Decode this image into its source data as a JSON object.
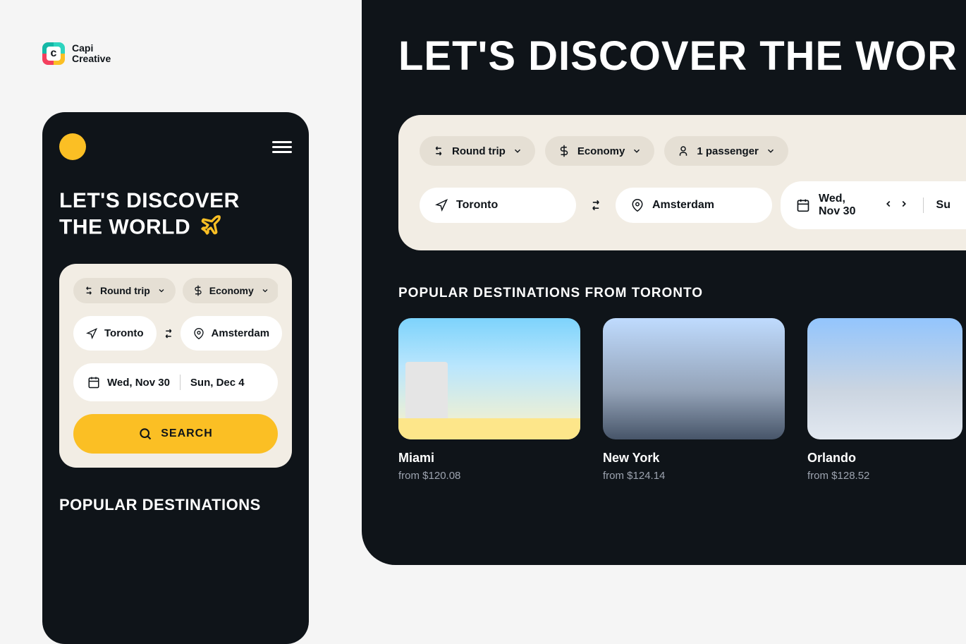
{
  "logo": {
    "line1": "Capi",
    "line2": "Creative"
  },
  "mobile": {
    "title_line1": "LET'S DISCOVER",
    "title_line2": "THE WORLD",
    "trip_type": "Round trip",
    "cabin": "Economy",
    "from": "Toronto",
    "to": "Amsterdam",
    "date_depart": "Wed, Nov 30",
    "date_return": "Sun, Dec 4",
    "search_label": "SEARCH",
    "section_title": "POPULAR DESTINATIONS"
  },
  "desktop": {
    "title": "LET'S DISCOVER THE WOR",
    "trip_type": "Round trip",
    "cabin": "Economy",
    "passengers": "1 passenger",
    "from": "Toronto",
    "to": "Amsterdam",
    "date_depart": "Wed, Nov 30",
    "date_return_partial": "Su",
    "section_title": "POPULAR DESTINATIONS FROM TORONTO",
    "destinations": [
      {
        "name": "Miami",
        "price": "from $120.08"
      },
      {
        "name": "New York",
        "price": "from $124.14"
      },
      {
        "name": "Orlando",
        "price": "from $128.52"
      }
    ]
  }
}
